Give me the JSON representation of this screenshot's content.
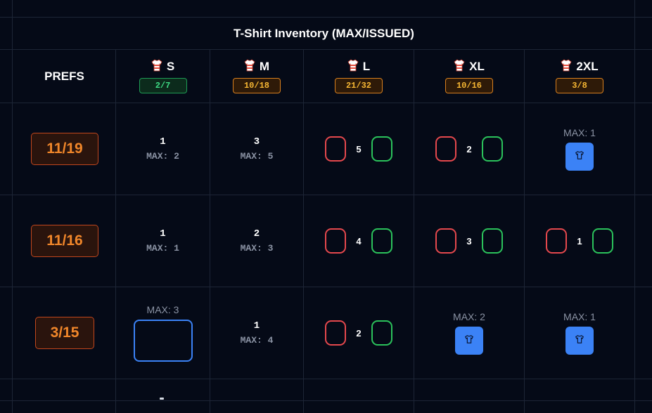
{
  "table": {
    "title": "T-Shirt Inventory (MAX/ISSUED)",
    "prefs_label": "PREFS",
    "sizes": [
      {
        "label": "S",
        "count": "2/7",
        "status": "ok"
      },
      {
        "label": "M",
        "count": "10/18",
        "status": "warn"
      },
      {
        "label": "L",
        "count": "21/32",
        "status": "warn"
      },
      {
        "label": "XL",
        "count": "10/16",
        "status": "warn"
      },
      {
        "label": "2XL",
        "count": "3/8",
        "status": "warn"
      }
    ],
    "rows": [
      {
        "date": "11/19",
        "cells": [
          {
            "type": "value",
            "value": "1",
            "max": "MAX: 2"
          },
          {
            "type": "value",
            "value": "3",
            "max": "MAX: 5"
          },
          {
            "type": "stepper",
            "value": "5"
          },
          {
            "type": "stepper",
            "value": "2"
          },
          {
            "type": "add",
            "max": "MAX: 1"
          }
        ]
      },
      {
        "date": "11/16",
        "cells": [
          {
            "type": "value",
            "value": "1",
            "max": "MAX: 1"
          },
          {
            "type": "value",
            "value": "2",
            "max": "MAX: 3"
          },
          {
            "type": "stepper",
            "value": "4"
          },
          {
            "type": "stepper",
            "value": "3"
          },
          {
            "type": "stepper",
            "value": "1"
          }
        ]
      },
      {
        "date": "3/15",
        "cells": [
          {
            "type": "empty-input",
            "max": "MAX: 3"
          },
          {
            "type": "value",
            "value": "1",
            "max": "MAX: 4"
          },
          {
            "type": "stepper",
            "value": "2"
          },
          {
            "type": "add",
            "max": "MAX: 2"
          },
          {
            "type": "add",
            "max": "MAX: 1"
          }
        ]
      }
    ]
  },
  "colors": {
    "background": "#050a17",
    "grid": "#1d2536",
    "pref_accent": "#f0862a",
    "ok": "#3ddc84",
    "warn": "#f7b733",
    "decrement": "#e5484d",
    "increment": "#2bc25b",
    "action": "#3b82f6"
  },
  "icons": {
    "size_header": "tshirt-icon",
    "add_button": "tshirt-icon"
  }
}
